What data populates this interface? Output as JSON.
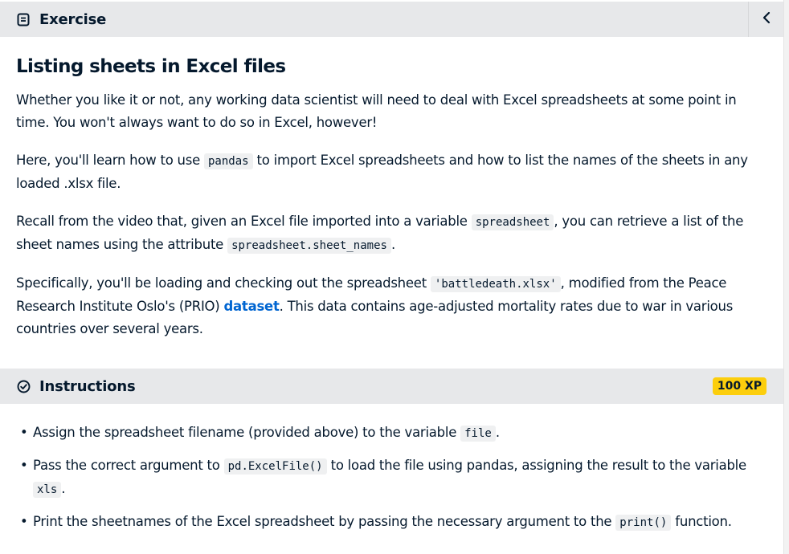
{
  "exercise_header": {
    "title": "Exercise",
    "icon": "document-icon",
    "collapse_icon": "chevron-left-icon"
  },
  "exercise": {
    "title": "Listing sheets in Excel files",
    "p1": "Whether you like it or not, any working data scientist will need to deal with Excel spreadsheets at some point in time. You won't always want to do so in Excel, however!",
    "p2_a": "Here, you'll learn how to use ",
    "p2_code": "pandas",
    "p2_b": " to import Excel spreadsheets and how to list the names of the sheets in any loaded .xlsx file.",
    "p3_a": "Recall from the video that, given an Excel file imported into a variable ",
    "p3_code1": "spreadsheet",
    "p3_b": ", you can retrieve a list of the sheet names using the attribute ",
    "p3_code2": "spreadsheet.sheet_names",
    "p3_c": ".",
    "p4_a": "Specifically, you'll be loading and checking out the spreadsheet ",
    "p4_code": "'battledeath.xlsx'",
    "p4_b": ", modified from the Peace Research Institute Oslo's (PRIO) ",
    "p4_link": "dataset",
    "p4_c": ". This data contains age-adjusted mortality rates due to war in various countries over several years."
  },
  "instructions_header": {
    "title": "Instructions",
    "icon": "check-circle-icon",
    "xp": "100 XP"
  },
  "instructions": {
    "bullet": "•",
    "i1_a": "Assign the spreadsheet filename (provided above) to the variable ",
    "i1_code": "file",
    "i1_b": ".",
    "i2_a": "Pass the correct argument to ",
    "i2_code1": "pd.ExcelFile()",
    "i2_b": " to load the file using pandas, assigning the result to the variable ",
    "i2_code2": "xls",
    "i2_c": ".",
    "i3_a": "Print the sheetnames of the Excel spreadsheet by passing the necessary argument to the ",
    "i3_code": "print()",
    "i3_b": " function."
  },
  "colors": {
    "header_bg": "#e7e8ea",
    "text": "#05192d",
    "link": "#0065d1",
    "xp_badge": "#fcce0d",
    "code_bg": "#eff0f1"
  }
}
